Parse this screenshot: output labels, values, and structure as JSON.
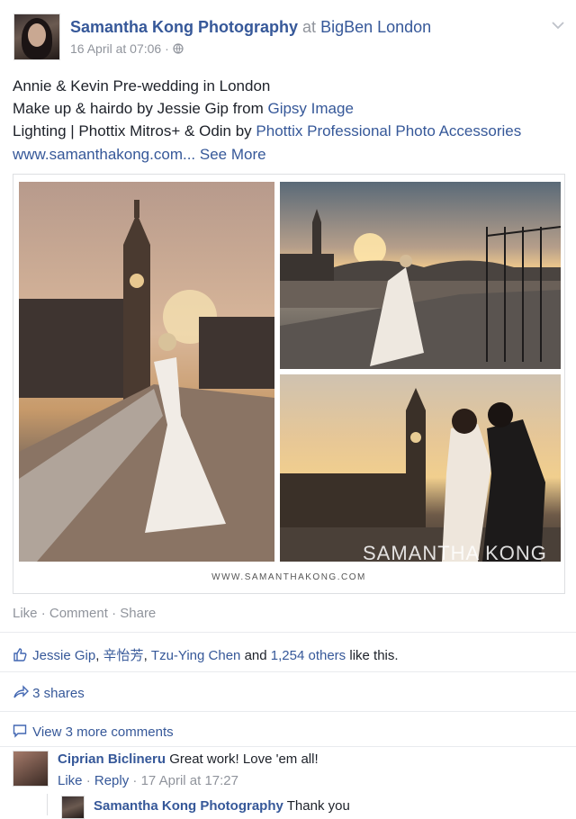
{
  "post": {
    "author": "Samantha Kong Photography",
    "at_word": "at",
    "place": "BigBen London",
    "date": "16 April at 07:06",
    "meta_sep": "·",
    "privacy_icon": "globe-icon",
    "menu_icon": "chevron-down-icon",
    "lines": [
      {
        "text": "Annie & Kevin Pre-wedding in London"
      },
      {
        "text": "Make up & hairdo by Jessie Gip from ",
        "link": "Gipsy Image"
      },
      {
        "text": "Lighting | Phottix Mitros+ & Odin by ",
        "link": "Phottix Professional Photo Accessories"
      }
    ],
    "url": "www.samanthakong.com...",
    "see_more": "See More",
    "watermark": "SAMANTHA KONG",
    "photo_caption": "WWW.SAMANTHAKONG.COM"
  },
  "actions": {
    "like": "Like",
    "comment": "Comment",
    "share": "Share",
    "sep": "·"
  },
  "likes": {
    "icon": "thumbs-up-icon",
    "names": [
      "Jessie Gip",
      "辛怡芳",
      "Tzu-Ying Chen"
    ],
    "and_word": "and",
    "others": "1,254 others",
    "suffix": "like this."
  },
  "shares": {
    "icon": "share-arrow-icon",
    "label": "3 shares"
  },
  "comments": {
    "icon": "comment-icon",
    "view_more": "View 3 more comments",
    "items": [
      {
        "author": "Ciprian Biclineru",
        "text": "Great work! Love 'em all!",
        "like": "Like",
        "reply": "Reply",
        "time": "17 April at 17:27"
      }
    ],
    "reply": {
      "author": "Samantha Kong Photography",
      "text": "Thank you"
    }
  },
  "colors": {
    "link": "#365899",
    "muted": "#90949c",
    "text": "#1d2129",
    "icon": "#4267b2"
  }
}
